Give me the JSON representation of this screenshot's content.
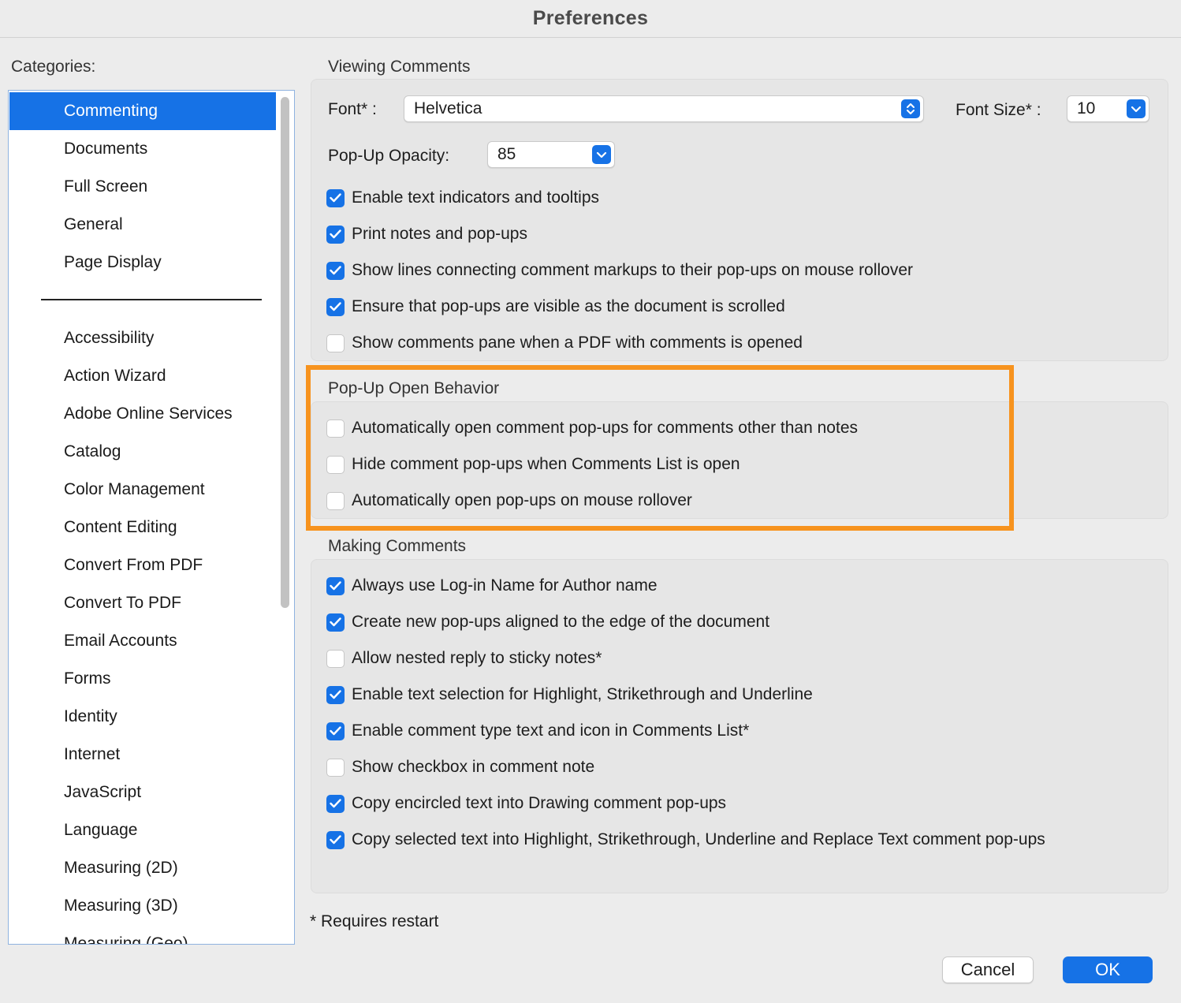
{
  "window": {
    "title": "Preferences"
  },
  "categories": {
    "label": "Categories:",
    "items": [
      {
        "label": "Commenting",
        "selected": true
      },
      {
        "label": "Documents"
      },
      {
        "label": "Full Screen"
      },
      {
        "label": "General"
      },
      {
        "label": "Page Display"
      },
      {
        "label": "Accessibility"
      },
      {
        "label": "Action Wizard"
      },
      {
        "label": "Adobe Online Services"
      },
      {
        "label": "Catalog"
      },
      {
        "label": "Color Management"
      },
      {
        "label": "Content Editing"
      },
      {
        "label": "Convert From PDF"
      },
      {
        "label": "Convert To PDF"
      },
      {
        "label": "Email Accounts"
      },
      {
        "label": "Forms"
      },
      {
        "label": "Identity"
      },
      {
        "label": "Internet"
      },
      {
        "label": "JavaScript"
      },
      {
        "label": "Language"
      },
      {
        "label": "Measuring (2D)"
      },
      {
        "label": "Measuring (3D)"
      },
      {
        "label": "Measuring (Geo)"
      }
    ]
  },
  "viewing": {
    "title": "Viewing Comments",
    "font_label": "Font* :",
    "font_value": "Helvetica",
    "font_size_label": "Font Size* :",
    "font_size_value": "10",
    "opacity_label": "Pop-Up Opacity:",
    "opacity_value": "85",
    "options": [
      {
        "label": "Enable text indicators and tooltips",
        "checked": true
      },
      {
        "label": "Print notes and pop-ups",
        "checked": true
      },
      {
        "label": "Show lines connecting comment markups to their pop-ups on mouse rollover",
        "checked": true
      },
      {
        "label": "Ensure that pop-ups are visible as the document is scrolled",
        "checked": true
      },
      {
        "label": "Show comments pane when a PDF with comments is opened",
        "checked": false
      }
    ]
  },
  "popup_behavior": {
    "title": "Pop-Up Open Behavior",
    "options": [
      {
        "label": "Automatically open comment pop-ups for comments other than notes",
        "checked": false
      },
      {
        "label": "Hide comment pop-ups when Comments List is open",
        "checked": false
      },
      {
        "label": "Automatically open pop-ups on mouse rollover",
        "checked": false
      }
    ]
  },
  "making": {
    "title": "Making Comments",
    "options": [
      {
        "label": "Always use Log-in Name for Author name",
        "checked": true
      },
      {
        "label": "Create new pop-ups aligned to the edge of the document",
        "checked": true
      },
      {
        "label": "Allow nested reply to sticky notes*",
        "checked": false
      },
      {
        "label": "Enable text selection for Highlight, Strikethrough and Underline",
        "checked": true
      },
      {
        "label": "Enable comment type text and icon in Comments List*",
        "checked": true
      },
      {
        "label": "Show checkbox in comment note",
        "checked": false
      },
      {
        "label": "Copy encircled text into Drawing comment pop-ups",
        "checked": true
      },
      {
        "label": "Copy selected text into Highlight, Strikethrough, Underline and Replace Text comment pop-ups",
        "checked": true
      }
    ]
  },
  "footnote": "* Requires restart",
  "buttons": {
    "cancel": "Cancel",
    "ok": "OK"
  },
  "colors": {
    "accent": "#1672e6",
    "highlight": "#f7931e"
  }
}
